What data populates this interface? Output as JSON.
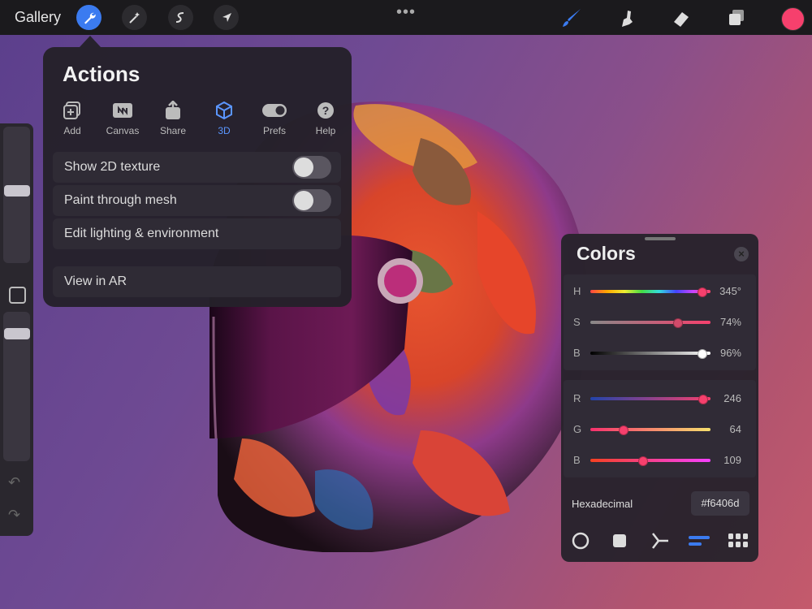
{
  "topbar": {
    "gallery_label": "Gallery",
    "more_label": "•••",
    "current_color": "#f6406d"
  },
  "actions": {
    "title": "Actions",
    "tabs": [
      {
        "label": "Add",
        "icon": "add-image-icon"
      },
      {
        "label": "Canvas",
        "icon": "canvas-icon"
      },
      {
        "label": "Share",
        "icon": "share-icon"
      },
      {
        "label": "3D",
        "icon": "cube-icon",
        "active": true
      },
      {
        "label": "Prefs",
        "icon": "toggle-icon"
      },
      {
        "label": "Help",
        "icon": "help-icon"
      }
    ],
    "rows": [
      {
        "label": "Show 2D texture",
        "toggle": false
      },
      {
        "label": "Paint through mesh",
        "toggle": false
      },
      {
        "label": "Edit lighting & environment"
      },
      {
        "label": "View in AR"
      }
    ]
  },
  "colors": {
    "title": "Colors",
    "hsb": [
      {
        "label": "H",
        "value": "345°",
        "fraction": 0.96
      },
      {
        "label": "S",
        "value": "74%",
        "fraction": 0.74
      },
      {
        "label": "B",
        "value": "96%",
        "fraction": 0.96
      }
    ],
    "rgb": [
      {
        "label": "R",
        "value": "246",
        "fraction": 0.965
      },
      {
        "label": "G",
        "value": "64",
        "fraction": 0.25
      },
      {
        "label": "B",
        "value": "109",
        "fraction": 0.43
      }
    ],
    "hex_label": "Hexadecimal",
    "hex_value": "#f6406d",
    "accent": "#3b7bf0"
  }
}
